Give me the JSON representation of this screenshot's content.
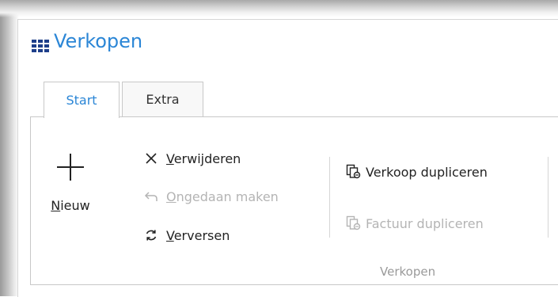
{
  "title": "Verkopen",
  "tabs": [
    {
      "label": "Start",
      "active": true
    },
    {
      "label": "Extra",
      "active": false
    }
  ],
  "ribbon": {
    "new_mnemonic": "N",
    "new_rest": "ieuw",
    "delete_mnemonic": "V",
    "delete_rest": "erwijderen",
    "undo_mnemonic": "O",
    "undo_rest": "ngedaan maken",
    "refresh_mnemonic": "V",
    "refresh_rest": "erversen",
    "duplicate_sale": "Verkoop dupliceren",
    "duplicate_invoice": "Factuur dupliceren",
    "group_label": "Verkopen"
  },
  "colors": {
    "accent": "#2b86d6",
    "disabled": "#b4b4b4"
  },
  "icons": {
    "title": "grid-icon",
    "new": "plus-icon",
    "delete": "close-icon",
    "undo": "undo-icon",
    "refresh": "refresh-icon",
    "duplicate": "duplicate-icon"
  }
}
